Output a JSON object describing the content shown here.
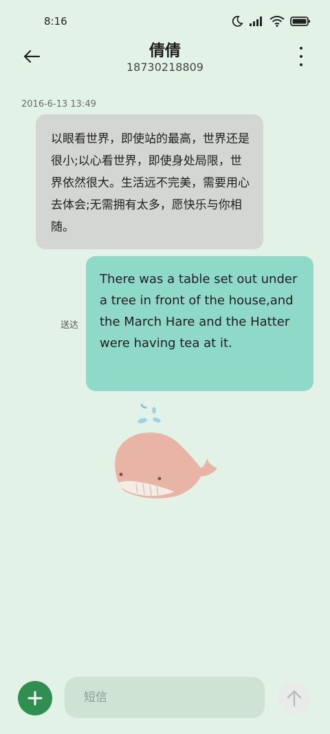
{
  "status_bar": {
    "time": "8:16"
  },
  "header": {
    "contact_name": "倩倩",
    "contact_number": "18730218809"
  },
  "messages": [
    {
      "direction": "incoming",
      "timestamp": "2016-6-13 13:49",
      "text": "以眼看世界，即使站的最高，世界还是很小;以心看世界，即使身处局限，世界依然很大。生活远不完美，需要用心去体会;无需拥有太多，愿快乐与你相随。"
    },
    {
      "direction": "outgoing",
      "status": "送达",
      "text": "There was a table set out under a tree in front of the house,and the March Hare and the Hatter were having tea at it."
    }
  ],
  "sticker": {
    "icon": "whale-sticker"
  },
  "composer": {
    "placeholder": "短信",
    "add_icon": "plus-icon",
    "send_icon": "arrow-up-icon"
  },
  "colors": {
    "background": "#e3f2e7",
    "incoming_bubble": "#d4d6d3",
    "outgoing_bubble": "#8fd9c9",
    "add_button": "#2f8f50",
    "whale": "#e8b4a6"
  }
}
